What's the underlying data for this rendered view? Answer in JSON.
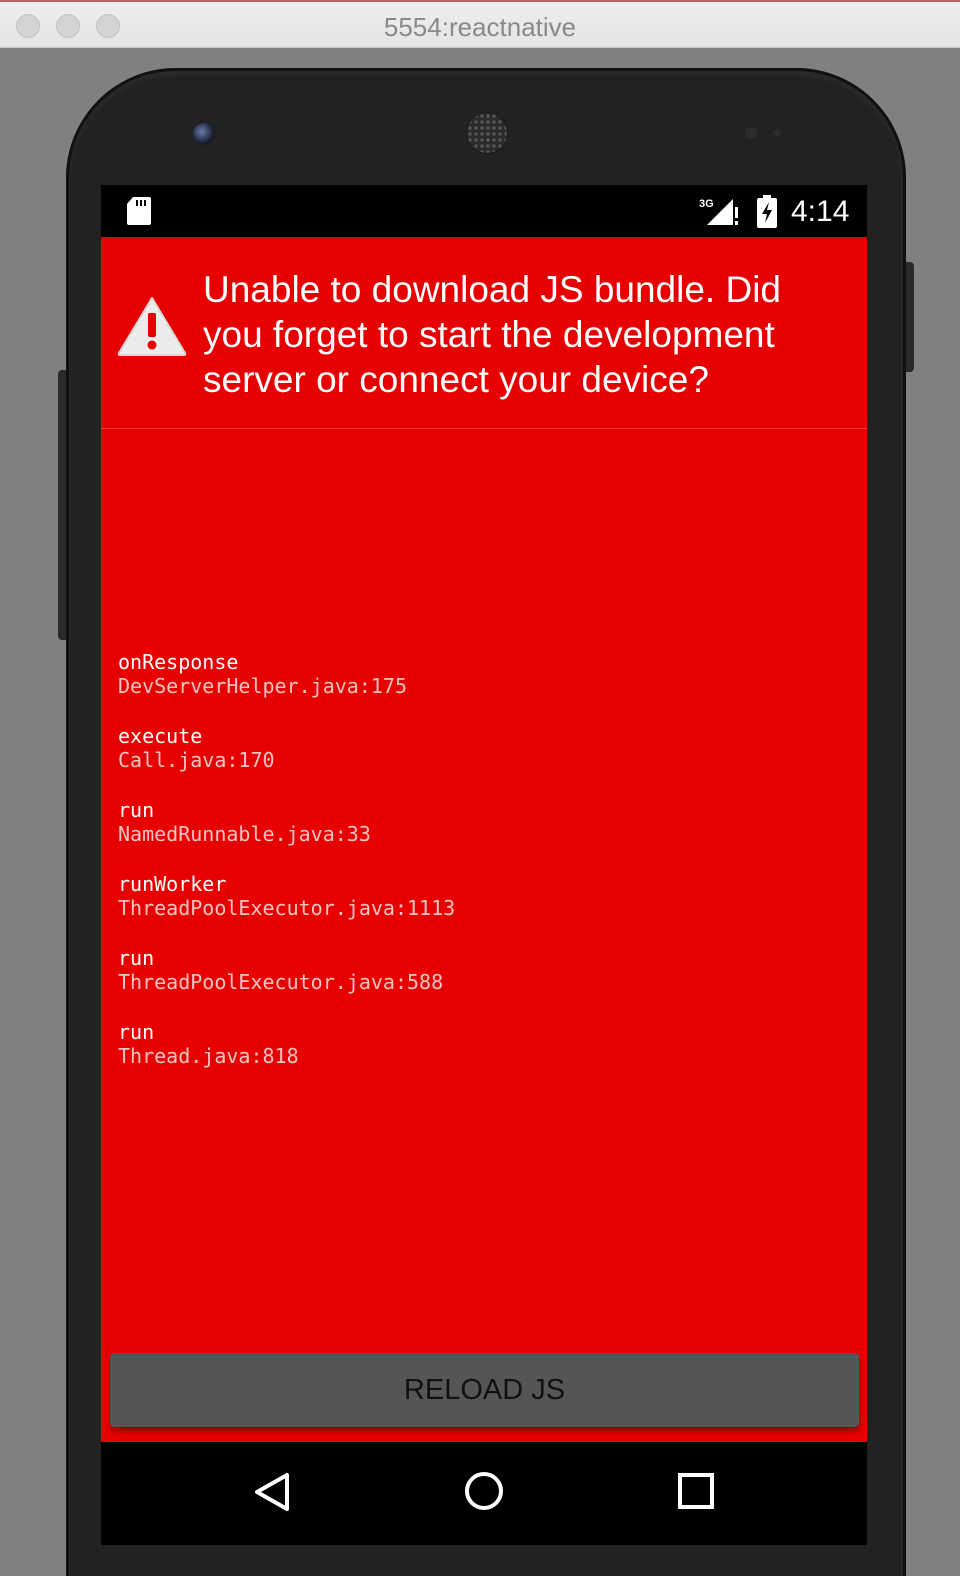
{
  "window": {
    "title": "5554:reactnative"
  },
  "status_bar": {
    "time": "4:14",
    "network_label": "3G",
    "icons": [
      "sd-card-icon",
      "signal-icon",
      "battery-charging-icon"
    ]
  },
  "error": {
    "title": "Unable to download JS bundle. Did you forget to start the development server or connect your device?",
    "icon": "warning-icon",
    "background_color": "#e60000"
  },
  "stack_trace": [
    {
      "method": "onResponse",
      "location": "DevServerHelper.java:175"
    },
    {
      "method": "execute",
      "location": "Call.java:170"
    },
    {
      "method": "run",
      "location": "NamedRunnable.java:33"
    },
    {
      "method": "runWorker",
      "location": "ThreadPoolExecutor.java:1113"
    },
    {
      "method": "run",
      "location": "ThreadPoolExecutor.java:588"
    },
    {
      "method": "run",
      "location": "Thread.java:818"
    }
  ],
  "actions": {
    "reload_label": "RELOAD JS"
  },
  "nav_bar": {
    "buttons": [
      "back-icon",
      "home-icon",
      "recents-icon"
    ]
  }
}
